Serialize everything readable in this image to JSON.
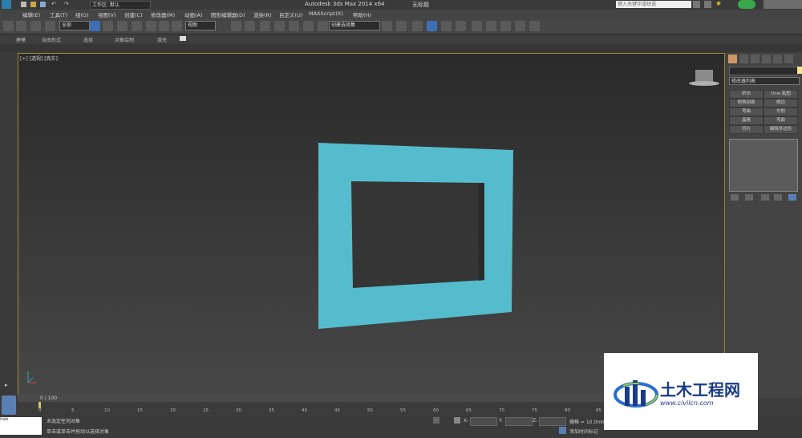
{
  "titlebar": {
    "workspace": "工作区: 默认",
    "app_title": "Autodesk 3ds Max  2014 x64",
    "doc_title": "无标题",
    "search_placeholder": "键入关键字或短语"
  },
  "menu": [
    "编辑(E)",
    "工具(T)",
    "组(G)",
    "视图(V)",
    "创建(C)",
    "修改器(M)",
    "动画(A)",
    "图形编辑器(D)",
    "渲染(R)",
    "自定义(U)",
    "MAXScript(X)",
    "帮助(H)"
  ],
  "toolbar": {
    "selection_filter": "全部",
    "ref_coord": "视图",
    "named_selection": "创建选择集"
  },
  "ribbon": {
    "tabs": [
      "建模",
      "自由形式",
      "选择",
      "对象绘制",
      "填充"
    ]
  },
  "viewport": {
    "label": "[+] [透视] [真实]"
  },
  "command_panel": {
    "modifier_list": "修改器列表",
    "buttons": [
      "挤出",
      "Unw 贴图",
      "倒角剖面",
      "倒边",
      "弯曲",
      "车削",
      "晶格",
      "弯曲",
      "切片",
      "编辑多边形"
    ]
  },
  "timeline": {
    "frame": "0 / 100",
    "ticks": [
      "0",
      "5",
      "10",
      "15",
      "20",
      "25",
      "30",
      "35",
      "40",
      "45",
      "50",
      "55",
      "60",
      "65",
      "70",
      "75",
      "80",
      "85"
    ]
  },
  "status": {
    "listener": "itab",
    "message": "未选定任何对象",
    "prompt": "单击或单击并拖动以选择对象",
    "x_label": "X:",
    "y_label": "Y:",
    "z_label": "Z:",
    "grid": "栅格 = 10.0mm",
    "add_key": "添加时间标记"
  },
  "watermark": {
    "title": "土木工程网",
    "url": "www.civilcn.com"
  },
  "colors": {
    "object": "#55bccd",
    "viewport_border": "#9a8a30",
    "accent": "#3d6fb5"
  }
}
